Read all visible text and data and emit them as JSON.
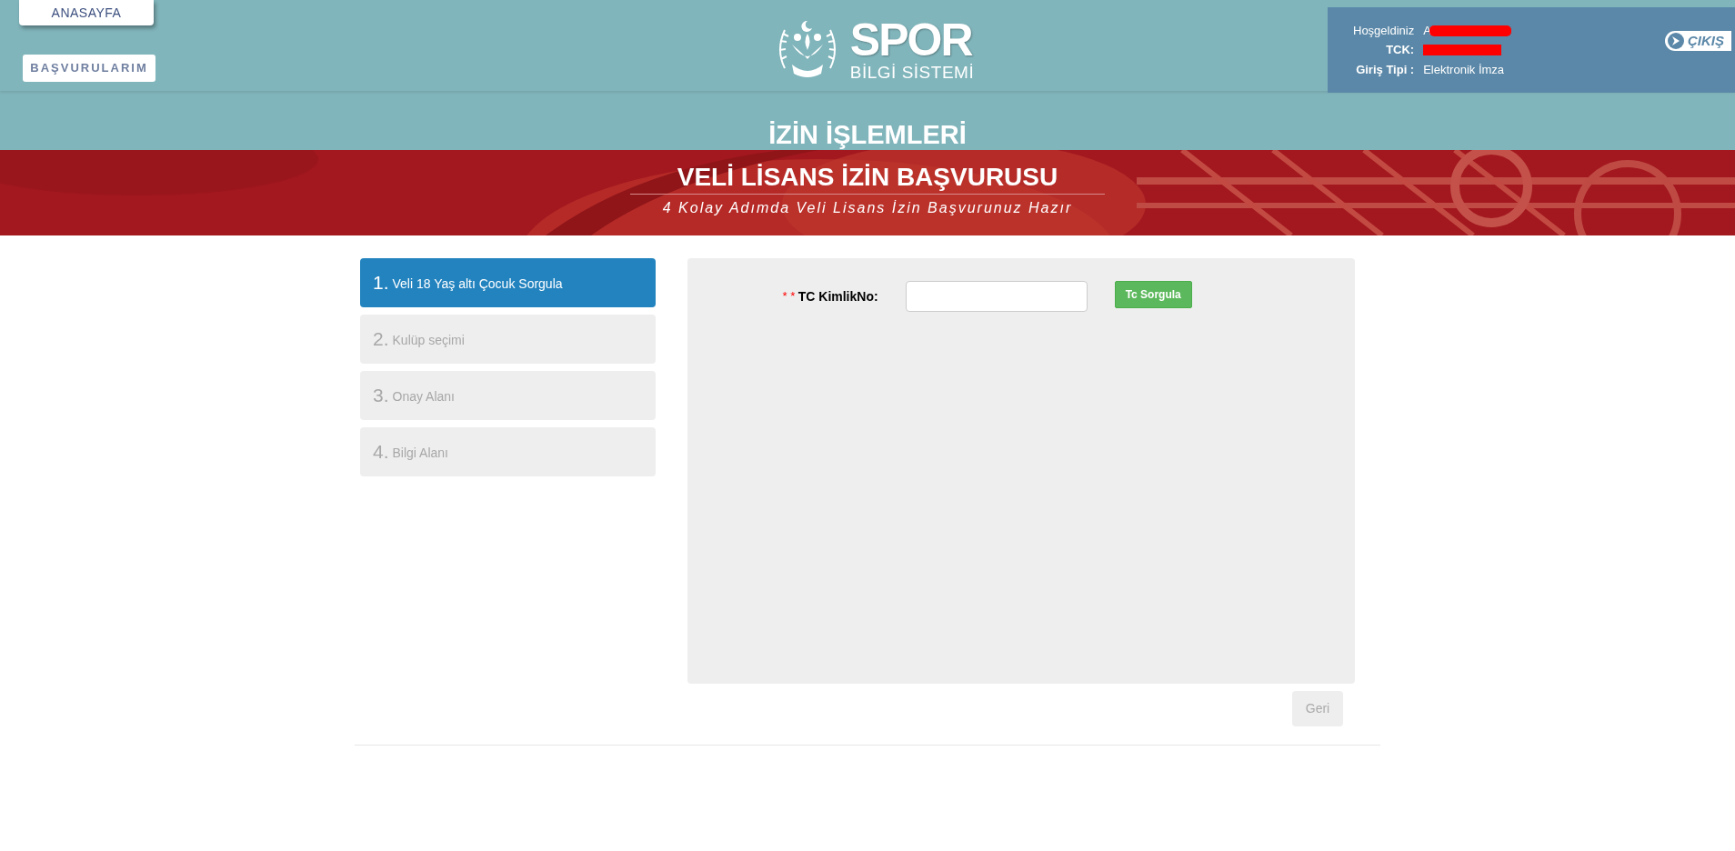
{
  "nav_buttons": [
    {
      "label": "ANASAYFA"
    },
    {
      "label": "BAŞVURULARIM"
    }
  ],
  "logo": {
    "title": "SPOR",
    "subtitle": "BİLGİ SİSTEMİ"
  },
  "user_panel": {
    "welcome_label": "Hoşgeldiniz",
    "welcome_value": "A",
    "tck_label": "TCK:",
    "login_type_label": "Giriş Tipi :",
    "login_type_value": "Elektronik İmza",
    "logout_label": "ÇIKIŞ"
  },
  "section_title": "İZİN İŞLEMLERİ",
  "banner": {
    "title": "VELİ LİSANS İZİN BAŞVURUSU",
    "subtitle": "4 Kolay Adımda Veli Lisans İzin Başvurunuz Hazır"
  },
  "steps": [
    {
      "number": "1.",
      "label": "Veli 18 Yaş altı Çocuk Sorgula",
      "selected": true
    },
    {
      "number": "2.",
      "label": "Kulüp seçimi",
      "selected": false
    },
    {
      "number": "3.",
      "label": "Onay Alanı",
      "selected": false
    },
    {
      "number": "4.",
      "label": "Bilgi Alanı",
      "selected": false
    }
  ],
  "form": {
    "required_mark": "* *",
    "field_label": "TC KimlikNo:",
    "query_button": "Tc Sorgula"
  },
  "back_button": {
    "label": "Geri",
    "disabled": true
  }
}
